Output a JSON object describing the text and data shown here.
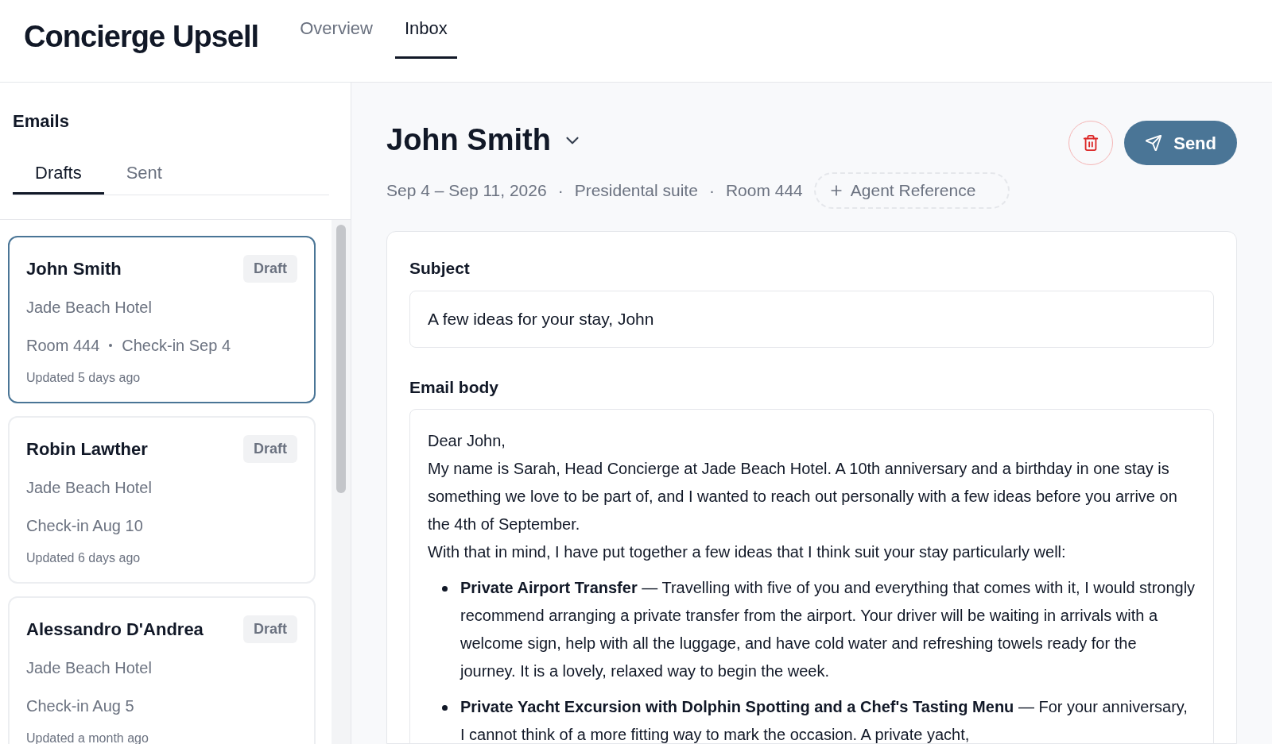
{
  "app_title": "Concierge Upsell",
  "nav_tabs": [
    {
      "label": "Overview",
      "selected": false
    },
    {
      "label": "Inbox",
      "selected": true
    }
  ],
  "sidebar": {
    "title": "Emails",
    "tabs": [
      {
        "label": "Drafts",
        "selected": true
      },
      {
        "label": "Sent",
        "selected": false
      }
    ],
    "emails": [
      {
        "name": "John Smith",
        "badge": "Draft",
        "hotel": "Jade Beach Hotel",
        "room": "Room 444",
        "checkin": "Check-in Sep 4",
        "updated": "Updated 5 days ago",
        "selected": true
      },
      {
        "name": "Robin Lawther",
        "badge": "Draft",
        "hotel": "Jade Beach Hotel",
        "checkin": "Check-in Aug 10",
        "updated": "Updated 6 days ago",
        "selected": false
      },
      {
        "name": "Alessandro D'Andrea",
        "badge": "Draft",
        "hotel": "Jade Beach Hotel",
        "checkin": "Check-in Aug 5",
        "updated": "Updated a month ago",
        "selected": false
      }
    ]
  },
  "detail": {
    "guest_name": "John Smith",
    "send_label": "Send",
    "meta": [
      "Sep 4 – Sep 11, 2026",
      "Presidental suite",
      "Room 444"
    ],
    "meta_separator": "·",
    "agent_reference": "Agent Reference",
    "subject_label": "Subject",
    "subject": "A few ideas for your stay, John",
    "body_label": "Email body",
    "body": [
      {
        "kind": "paragraph",
        "text": "Dear John,"
      },
      {
        "kind": "paragraph",
        "text": "My name is Sarah, Head Concierge at Jade Beach Hotel. A 10th anniversary and a birthday in one stay is something we love to be part of, and I wanted to reach out personally with a few ideas before you arrive on the 4th of September."
      },
      {
        "kind": "paragraph",
        "text": "With that in mind, I have put together a few ideas that I think suit your stay particularly well:"
      },
      {
        "kind": "bullet",
        "text": "**Private Airport Transfer** — Travelling with five of you and everything that comes with it, I would strongly recommend arranging a private transfer from the airport. Your driver will be waiting in arrivals with a welcome sign, help with all the luggage, and have cold water and refreshing towels ready for the journey. It is a lovely, relaxed way to begin the week."
      },
      {
        "kind": "bullet",
        "text": "**Private Yacht Excursion with Dolphin Spotting and a Chef's Tasting Menu** — For your anniversary, I cannot think of a more fitting way to mark the occasion. A private yacht,"
      }
    ]
  }
}
